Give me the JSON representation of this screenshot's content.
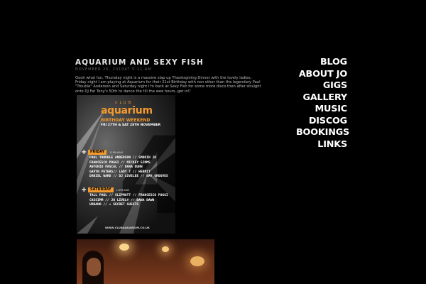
{
  "post": {
    "title": "AQUARIUM AND SEXY FISH",
    "date": "NOVEMBER 26, 2010AT 5:11 AM",
    "body": "Oooh what fun, Thursday night is a massive slap up Thanksgiving Dinner with the lovely ladies, Friday night I am playing at Aquarium for their 21st Birthday with non other than the legendary Paul \"Trouble\" Anderson and Saturday night I'm back at Sexy Fish for some more disco then after straight onto DJ Fat Tony's 50th to dance the till the wee hours..get in!!"
  },
  "flyer": {
    "club": "CLUB",
    "name": "aquarium",
    "event": "BIRTHDAY WEEKEND",
    "dates": "FRI 27TH & SAT 28TH NOVEMBER",
    "big_number": "4",
    "friday": {
      "label": "FRIDAY",
      "time": "11PM-6AM"
    },
    "friday_lineup": [
      "PAUL TROUBLE ANDERSON // SMOKIN JO",
      "FRANCESCO POGGI // MICKEY SIMMS",
      "ANTONIO PASCAL // DANA DUNN",
      "GAVYN PETERS// LADY T // HERMIT",
      "DANIEL WARD // DJ LOVELEE // BAY GROOVES"
    ],
    "saturday": {
      "label": "SATURDAY",
      "time": "11PM-6AM"
    },
    "saturday_lineup": [
      "TALL PAUL // SLIPMATT // FRANCESCO POGGI",
      "CASSIMM // JO LIVELY // DANA DAWN",
      "URBANO // + SECRET GUESTS"
    ],
    "url": "WWW.CLUBAQUARIUM.CO.UK",
    "accent": "#f29a2e"
  },
  "nav": {
    "items": [
      "BLOG",
      "ABOUT JO",
      "GIGS",
      "GALLERY",
      "MUSIC",
      "DISCOG",
      "BOOKINGS",
      "LINKS"
    ]
  },
  "colors": {
    "background": "#000000",
    "text": "#ffffff"
  }
}
